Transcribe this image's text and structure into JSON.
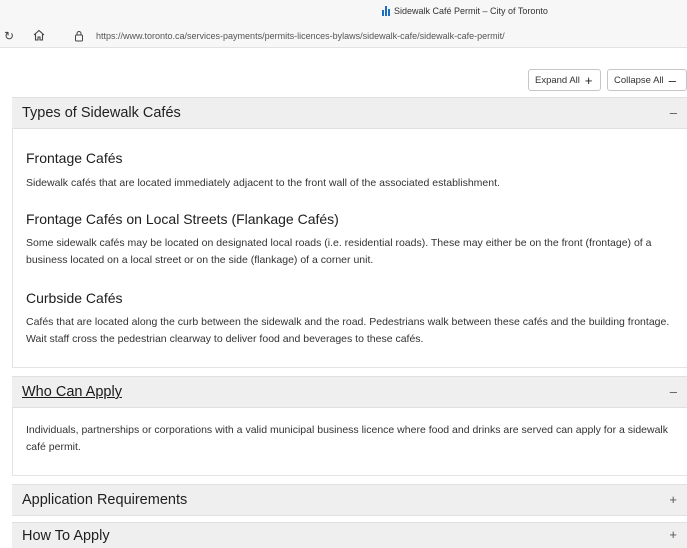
{
  "browser": {
    "tab_title": "Sidewalk Café Permit – City of Toronto",
    "url": "https://www.toronto.ca/services-payments/permits-licences-bylaws/sidewalk-cafe/sidewalk-cafe-permit/"
  },
  "toolbar": {
    "expand_label": "Expand All",
    "expand_symbol": "+",
    "collapse_label": "Collapse All",
    "collapse_symbol": "–"
  },
  "sections": {
    "types": {
      "title": "Types of Sidewalk Cafés",
      "toggle": "–",
      "items": [
        {
          "heading": "Frontage Cafés",
          "text": "Sidewalk cafés that are located immediately adjacent to the front wall of the associated establishment."
        },
        {
          "heading": "Frontage Cafés on Local Streets (Flankage Cafés)",
          "text": "Some sidewalk cafés may be located on designated local roads (i.e. residential roads). These may either be on the front (frontage) of a business located on a local street or on the side (flankage) of a corner unit."
        },
        {
          "heading": "Curbside Cafés",
          "text": "Cafés that are located along the curb between the sidewalk and the road. Pedestrians walk between these cafés and the building frontage. Wait staff cross the pedestrian clearway to deliver food and beverages to these cafés."
        }
      ]
    },
    "who": {
      "title": "Who Can Apply",
      "toggle": "–",
      "text": "Individuals, partnerships or corporations with a valid municipal business licence where food and drinks are served can apply for a sidewalk café permit."
    },
    "requirements": {
      "title": "Application Requirements",
      "toggle": "+"
    },
    "how": {
      "title": "How To Apply",
      "toggle": "+"
    }
  }
}
